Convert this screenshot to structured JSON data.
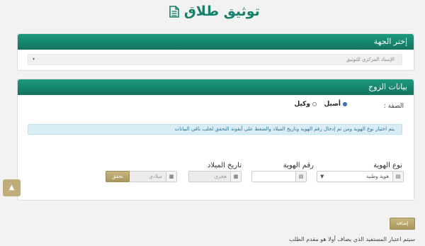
{
  "page": {
    "title": "توثيق طلاق"
  },
  "entity_section": {
    "heading": "إختر الجهة",
    "select_value": "الإسناد المركزي للتوثيق"
  },
  "husband_section": {
    "heading": "بيانات الزوج",
    "capacity_label": "الصفة :",
    "option_principal": "أصيل",
    "option_agent": "وكيل",
    "info_message": "يتم اختيار نوع الهوية ومن ثم إدخال رقم الهوية وتاريخ الميلاد والضغط على أيقونة التحقق لجلب باقي البيانات",
    "id_type_label": "نوع الهوية",
    "id_type_value": "هوية وطنية",
    "id_number_label": "رقم الهوية",
    "id_number_value": "",
    "birth_date_label": "تاريخ الميلاد",
    "hijri_placeholder": "هجري",
    "gregorian_placeholder": "ميلادي",
    "verify_label": "تحقق"
  },
  "actions": {
    "add_label": "إضافة"
  },
  "footer": {
    "note": "سيتم اعتبار المستفيد الذي يضاف أولا هو مقدم الطلب"
  },
  "icons": [
    "document-icon",
    "card-icon",
    "calendar-icon",
    "chevron-down-icon",
    "chevron-up-icon"
  ],
  "colors": {
    "header_green": "#17806a",
    "gold_button": "#b5a36c",
    "info_bg": "#d9edf7"
  }
}
